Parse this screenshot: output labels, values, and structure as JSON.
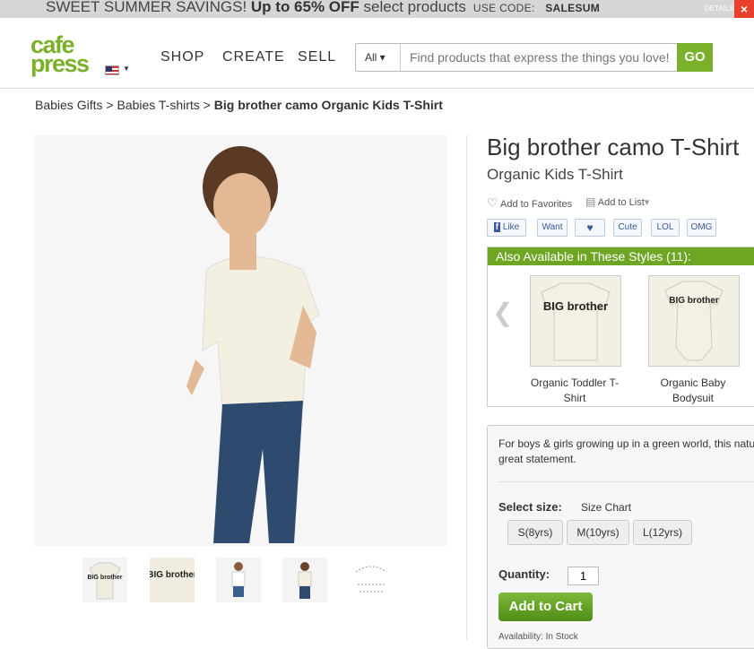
{
  "promo": {
    "text_a": "SWEET SUMMER SAVINGS! ",
    "bold": "Up to 65% OFF",
    "text_b": " select products",
    "code_label": "USE CODE: ",
    "code": "SALESUM",
    "details": "DETAILS"
  },
  "header": {
    "logo_line1": "cafe",
    "logo_line2": "press",
    "nav": [
      "SHOP",
      "CREATE",
      "SELL"
    ],
    "search": {
      "category": "All",
      "placeholder": "Find products that express the things you love!",
      "go": "GO"
    }
  },
  "breadcrumb": {
    "items": [
      "Babies Gifts",
      "Babies T-shirts"
    ],
    "current": "Big brother camo Organic Kids T-Shirt",
    "sep": " > "
  },
  "product": {
    "title": "Big brother camo T-Shirt",
    "subtitle": "Organic Kids T-Shirt",
    "add_favorites": "Add to Favorites",
    "add_list": "Add to List",
    "social": [
      "Like",
      "Want",
      "Cute",
      "LOL",
      "OMG"
    ]
  },
  "styles": {
    "heading": "Also Available in These Styles (11):",
    "items": [
      {
        "label": "Organic Toddler T-Shirt",
        "print": "BIG brother"
      },
      {
        "label": "Organic Baby Bodysuit",
        "print": "BIG brother"
      }
    ]
  },
  "purchase": {
    "description": "For boys & girls growing up in a green world, this natu great statement.",
    "select_size": "Select size:",
    "size_chart": "Size Chart",
    "sizes": [
      "S(8yrs)",
      "M(10yrs)",
      "L(12yrs)"
    ],
    "quantity_label": "Quantity:",
    "quantity": "1",
    "add_to_cart": "Add to Cart",
    "availability": "Availability: In Stock"
  },
  "thumbnails": {
    "print_text": "BIG brother"
  },
  "colors": {
    "brand_green": "#7bb02a",
    "styles_header": "#6ea522"
  }
}
